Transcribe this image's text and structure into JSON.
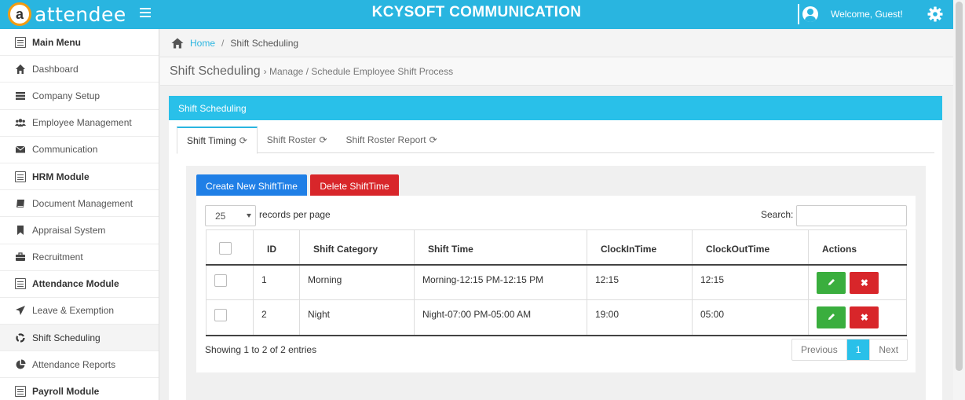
{
  "header": {
    "logo_letter": "a",
    "logo_text": "attendee",
    "company": "KCYSOFT COMMUNICATION",
    "welcome": "Welcome, Guest!",
    "accent_color": "#29b5e0"
  },
  "sidebar": {
    "items": [
      {
        "label": "Main Menu",
        "icon": "menu-list-icon"
      },
      {
        "label": "Dashboard",
        "icon": "home-icon"
      },
      {
        "label": "Company Setup",
        "icon": "server-icon"
      },
      {
        "label": "Employee Management",
        "icon": "users-icon"
      },
      {
        "label": "Communication",
        "icon": "envelope-icon"
      },
      {
        "label": "HRM Module",
        "icon": "menu-list-icon"
      },
      {
        "label": "Document Management",
        "icon": "book-icon"
      },
      {
        "label": "Appraisal System",
        "icon": "bookmark-icon"
      },
      {
        "label": "Recruitment",
        "icon": "briefcase-icon"
      },
      {
        "label": "Attendance Module",
        "icon": "menu-list-icon"
      },
      {
        "label": "Leave & Exemption",
        "icon": "plane-icon"
      },
      {
        "label": "Shift Scheduling",
        "icon": "recycle-icon"
      },
      {
        "label": "Attendance Reports",
        "icon": "pie-chart-icon"
      },
      {
        "label": "Payroll Module",
        "icon": "menu-list-icon"
      }
    ]
  },
  "breadcrumb": {
    "home": "Home",
    "separator": "/",
    "current": "Shift Scheduling"
  },
  "page": {
    "title": "Shift Scheduling",
    "subtitle": "› Manage / Schedule Employee Shift Process"
  },
  "panel": {
    "title": "Shift Scheduling",
    "tabs": [
      {
        "label": "Shift Timing"
      },
      {
        "label": "Shift Roster"
      },
      {
        "label": "Shift Roster Report"
      }
    ],
    "create_label": "Create New ShiftTime",
    "delete_label": "Delete ShiftTime"
  },
  "table": {
    "length_value": "25",
    "length_label": "records per page",
    "search_label": "Search:",
    "columns": [
      "",
      "ID",
      "Shift Category",
      "Shift Time",
      "ClockInTime",
      "ClockOutTime",
      "Actions"
    ],
    "rows": [
      {
        "id": "1",
        "category": "Morning",
        "time": "Morning-12:15 PM-12:15 PM",
        "clock_in": "12:15",
        "clock_out": "12:15"
      },
      {
        "id": "2",
        "category": "Night",
        "time": "Night-07:00 PM-05:00 AM",
        "clock_in": "19:00",
        "clock_out": "05:00"
      }
    ],
    "info": "Showing 1 to 2 of 2 entries",
    "pager": {
      "previous": "Previous",
      "current": "1",
      "next": "Next"
    }
  }
}
